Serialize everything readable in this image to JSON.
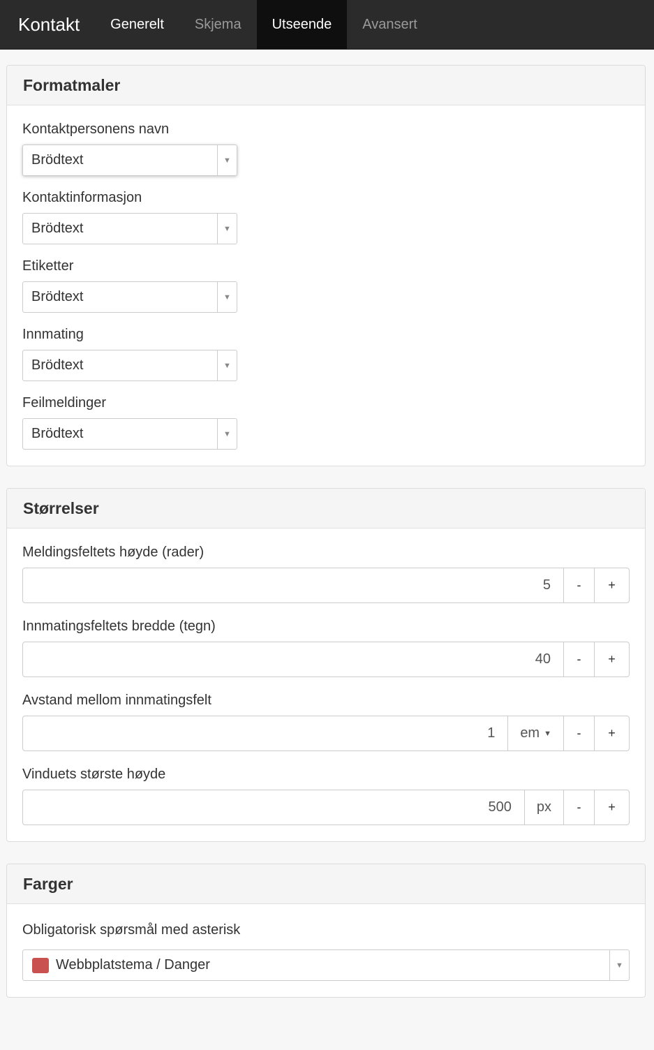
{
  "header": {
    "title": "Kontakt",
    "tabs": [
      {
        "label": "Generelt"
      },
      {
        "label": "Skjema"
      },
      {
        "label": "Utseende"
      },
      {
        "label": "Avansert"
      }
    ]
  },
  "formatmaler": {
    "title": "Formatmaler",
    "fields": [
      {
        "label": "Kontaktpersonens navn",
        "value": "Brödtext"
      },
      {
        "label": "Kontaktinformasjon",
        "value": "Brödtext"
      },
      {
        "label": "Etiketter",
        "value": "Brödtext"
      },
      {
        "label": "Innmating",
        "value": "Brödtext"
      },
      {
        "label": "Feilmeldinger",
        "value": "Brödtext"
      }
    ]
  },
  "storrelser": {
    "title": "Størrelser",
    "fields": [
      {
        "label": "Meldingsfeltets høyde (rader)",
        "value": "5"
      },
      {
        "label": "Innmatingsfeltets bredde (tegn)",
        "value": "40"
      },
      {
        "label": "Avstand mellom innmatingsfelt",
        "value": "1",
        "unit": "em"
      },
      {
        "label": "Vinduets største høyde",
        "value": "500",
        "unit": "px"
      }
    ],
    "minus": "-",
    "plus": "+"
  },
  "farger": {
    "title": "Farger",
    "field": {
      "label": "Obligatorisk spørsmål med asterisk",
      "value": "Webbplatstema / Danger",
      "swatch_color": "#c9514f"
    }
  },
  "colors": {
    "topbar": "#2b2b2b",
    "active_tab": "#0f0f0f"
  }
}
